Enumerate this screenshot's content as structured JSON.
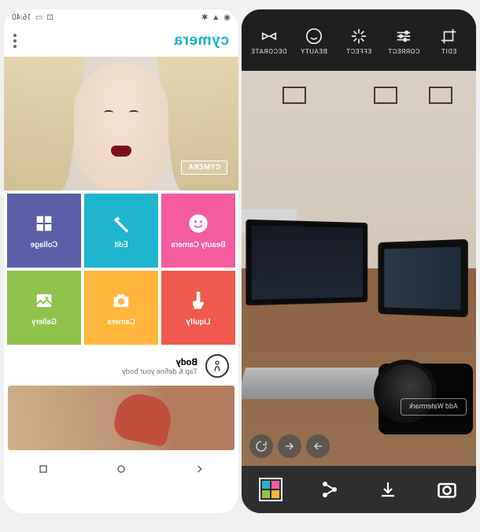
{
  "editor": {
    "toolbar": [
      {
        "name": "edit",
        "label": "EDIT"
      },
      {
        "name": "correct",
        "label": "CORRECT"
      },
      {
        "name": "effect",
        "label": "EFFECT"
      },
      {
        "name": "beauty",
        "label": "BEAUTY"
      },
      {
        "name": "decorate",
        "label": "DECORATE"
      }
    ],
    "watermark_label": "Add Watermark"
  },
  "home": {
    "status_time": "16:40",
    "brand": "cymera",
    "hero_badge": "CYMERA",
    "tiles": [
      {
        "name": "beauty-camera",
        "label": "Beauty Camera",
        "color": "#f45c9f"
      },
      {
        "name": "edit",
        "label": "Edit",
        "color": "#1eb5ce"
      },
      {
        "name": "collage",
        "label": "Collage",
        "color": "#5b5fa8"
      },
      {
        "name": "liquify",
        "label": "Liquify",
        "color": "#ef5a4c"
      },
      {
        "name": "camera",
        "label": "Camera",
        "color": "#ffb63a"
      },
      {
        "name": "gallery",
        "label": "Gallery",
        "color": "#8fc24b"
      }
    ],
    "promo": {
      "title": "Body",
      "subtitle": "Tap & define your body"
    }
  }
}
